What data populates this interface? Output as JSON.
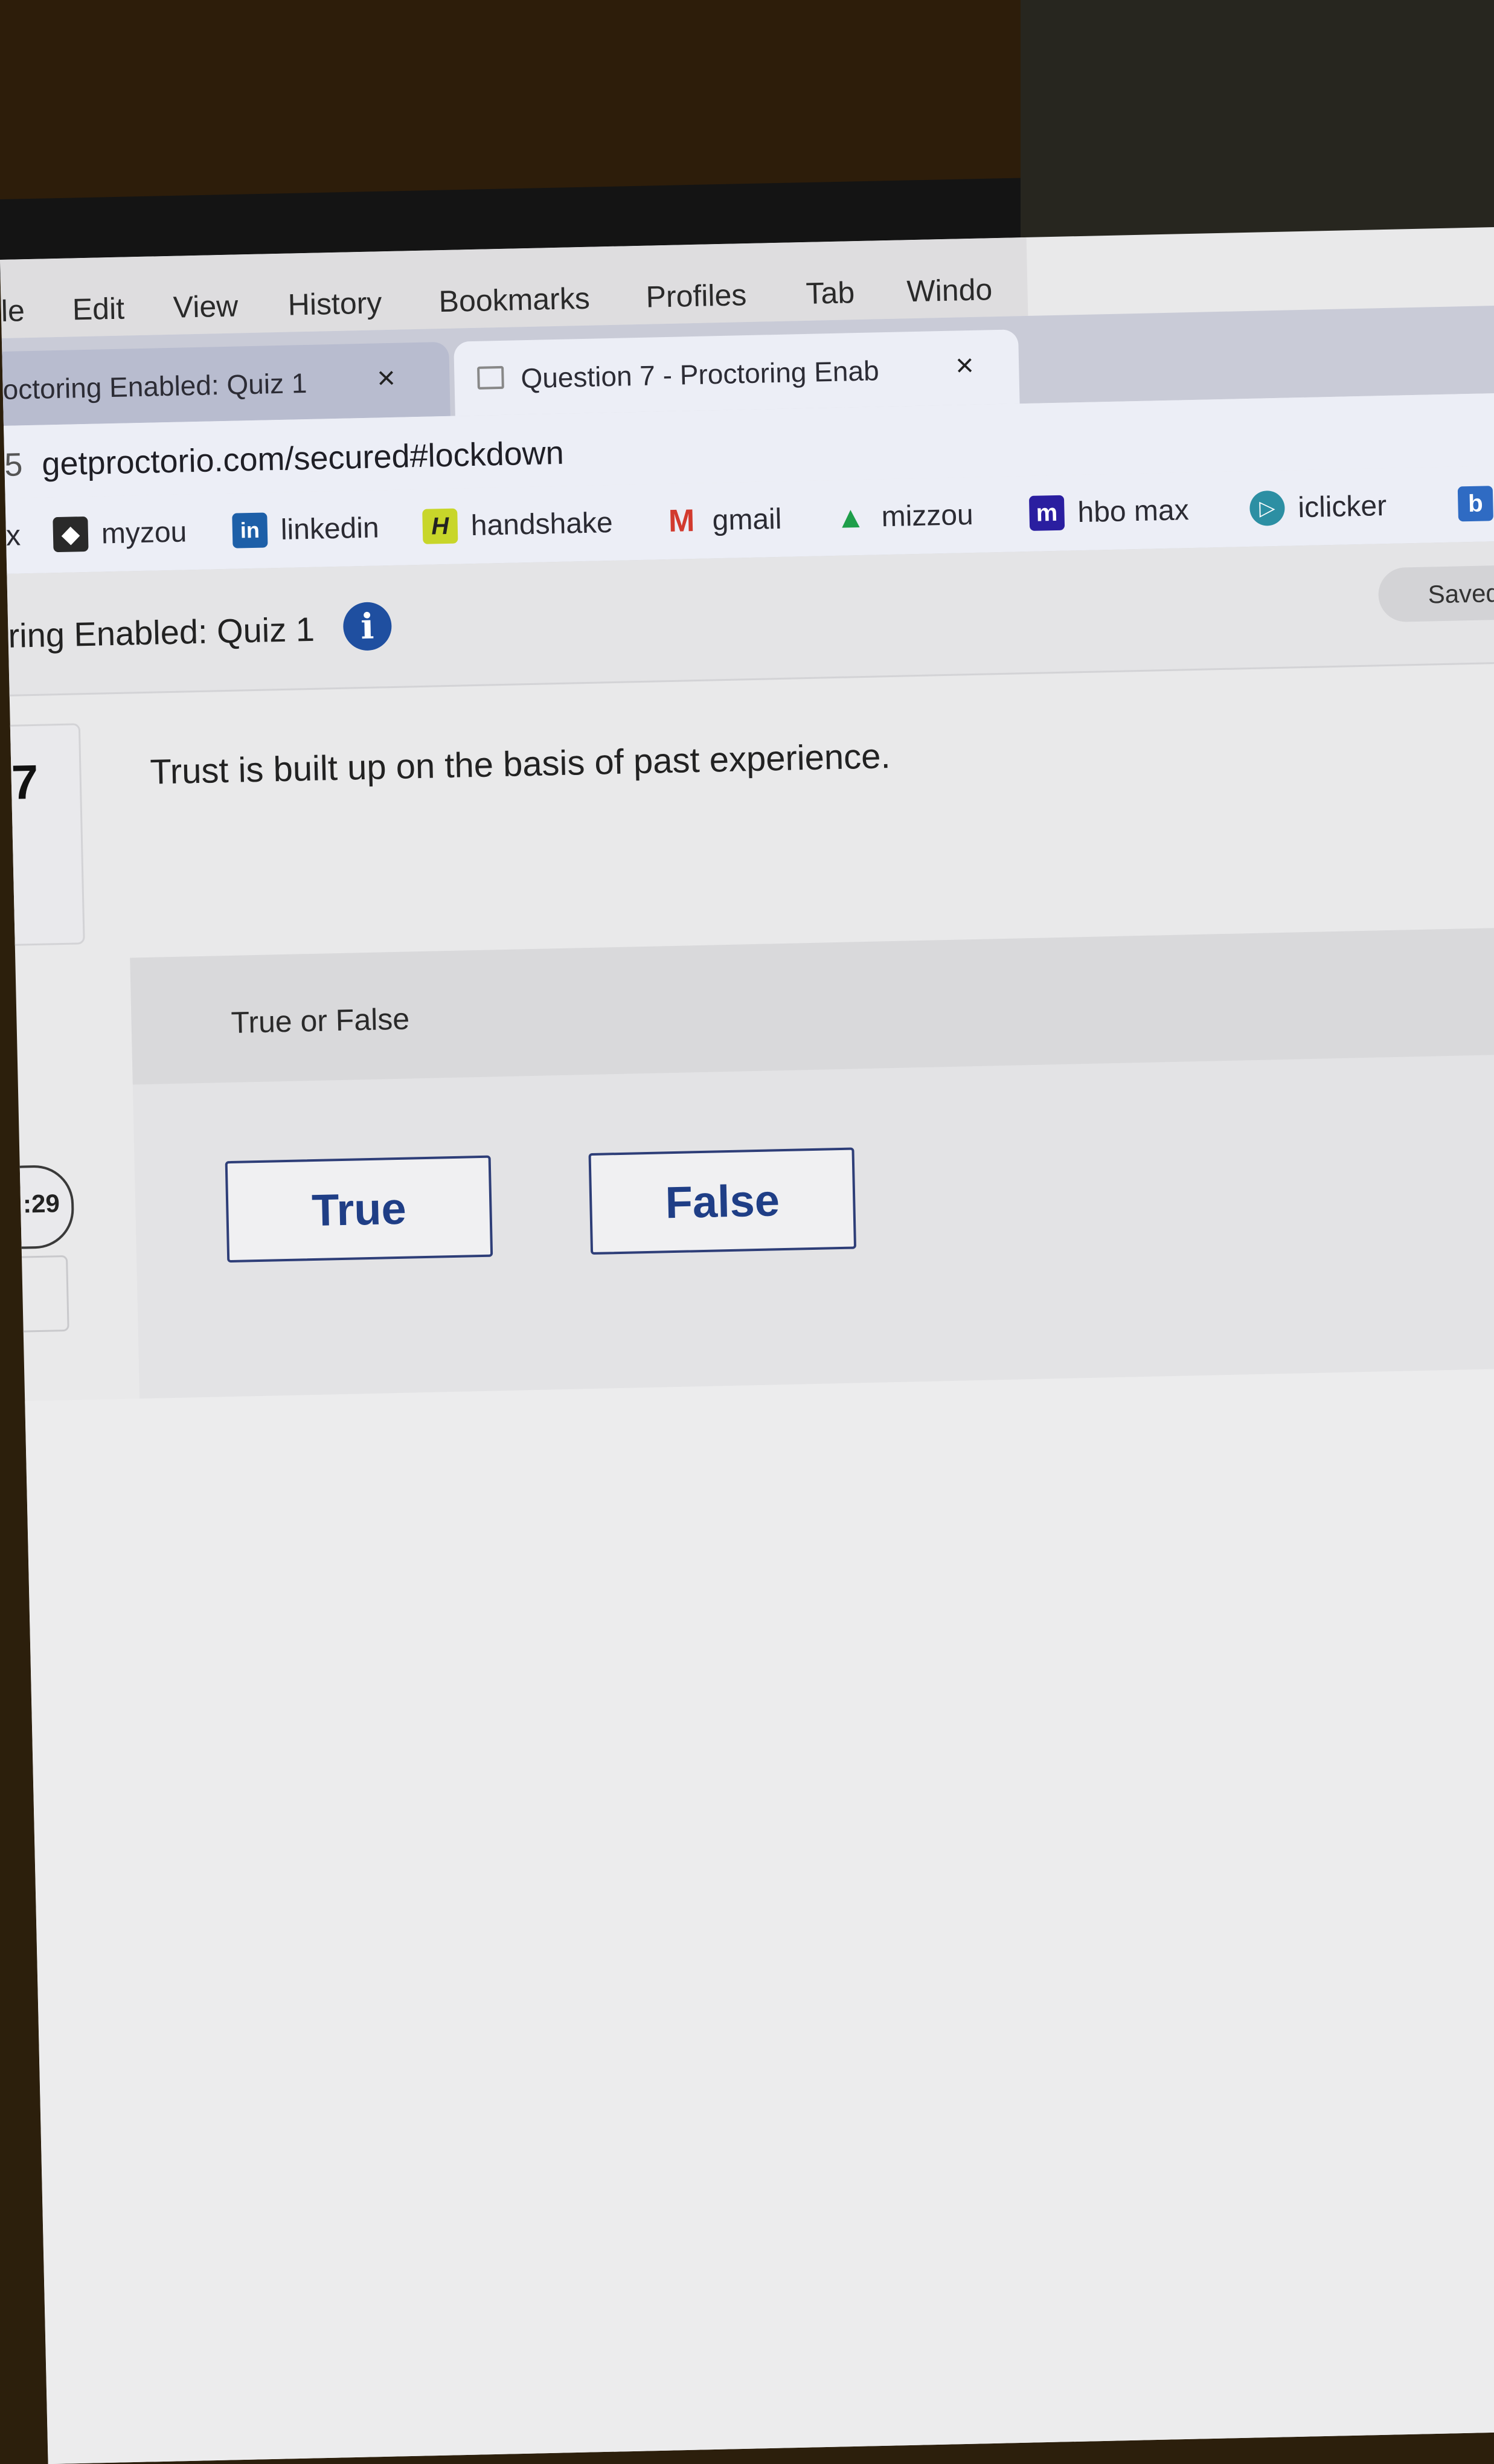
{
  "menubar": {
    "items": [
      "le",
      "Edit",
      "View",
      "History",
      "Bookmarks",
      "Profiles",
      "Tab",
      "Windo"
    ]
  },
  "tabs": [
    {
      "label": "octoring Enabled: Quiz 1",
      "close": "×"
    },
    {
      "label": "Question 7 - Proctoring Enab",
      "close": "×"
    }
  ],
  "urlbar": {
    "prefix": "5",
    "url": "getproctorio.com/secured#lockdown"
  },
  "bookmarks": [
    {
      "label": "x",
      "icon": "x-fragment",
      "color": "#ffffff"
    },
    {
      "label": "myzou",
      "icon": "myzou-tiger-icon",
      "color": "#222222"
    },
    {
      "label": "linkedin",
      "icon": "linkedin-icon",
      "color": "#1d5fa8"
    },
    {
      "label": "handshake",
      "icon": "handshake-icon",
      "color": "#c8d62a"
    },
    {
      "label": "gmail",
      "icon": "gmail-icon",
      "color": "#d23a2e"
    },
    {
      "label": "mizzou",
      "icon": "google-drive-icon",
      "color": "#f2b91c"
    },
    {
      "label": "hbo max",
      "icon": "hbo-max-icon",
      "color": "#2a1ea0"
    },
    {
      "label": "iclicker",
      "icon": "iclicker-icon",
      "color": "#2c8fa3"
    },
    {
      "label": "b",
      "icon": "b-icon",
      "color": "#2f6bc3"
    }
  ],
  "quiz": {
    "title": "ring Enabled: Quiz 1",
    "info_icon": "i",
    "saved": "Saved",
    "question_number": "7",
    "question_text": "Trust is built up on the basis of past experience.",
    "answer_type": "True or False",
    "answers": [
      "True",
      "False"
    ],
    "timer": ":29"
  }
}
